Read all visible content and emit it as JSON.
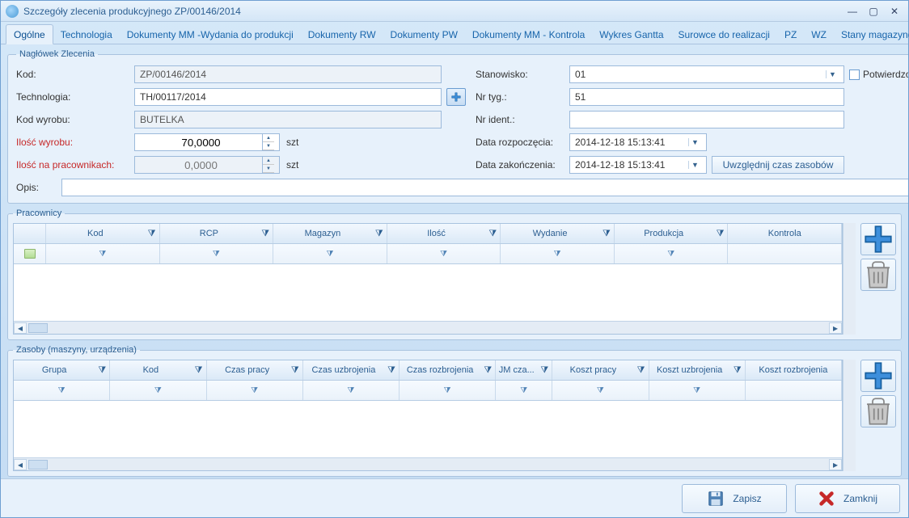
{
  "window": {
    "title": "Szczegóły zlecenia produkcyjnego ZP/00146/2014"
  },
  "tabs": {
    "items": [
      "Ogólne",
      "Technologia",
      "Dokumenty MM -Wydania do produkcji",
      "Dokumenty RW",
      "Dokumenty PW",
      "Dokumenty MM - Kontrola",
      "Wykres Gantta",
      "Surowce do realizacji",
      "PZ",
      "WZ",
      "Stany magazynowe"
    ],
    "active_index": 0
  },
  "header_panel": {
    "legend": "Nagłówek Zlecenia",
    "labels": {
      "kod": "Kod:",
      "technologia": "Technologia:",
      "kodwyrobu": "Kod wyrobu:",
      "iloscwyrobu": "Ilość wyrobu:",
      "iloscprac": "Ilość na pracownikach:",
      "opis": "Opis:",
      "stanowisko": "Stanowisko:",
      "nrtyg": "Nr tyg.:",
      "nrident": "Nr ident.:",
      "datarozp": "Data rozpoczęcia:",
      "datazak": "Data zakończenia:",
      "potwierdzone": "Potwierdzone",
      "uwzglednij": "Uwzględnij czas zasobów",
      "szt": "szt"
    },
    "values": {
      "kod": "ZP/00146/2014",
      "technologia": "TH/00117/2014",
      "kodwyrobu": "BUTELKA",
      "iloscwyrobu": "70,0000",
      "iloscprac": "0,0000",
      "opis": "",
      "stanowisko": "01",
      "nrtyg": "51",
      "nrident": "",
      "datarozp": "2014-12-18 15:13:41",
      "datazak": "2014-12-18 15:13:41"
    }
  },
  "pracownicy": {
    "legend": "Pracownicy",
    "columns": [
      "",
      "Kod",
      "RCP",
      "Magazyn",
      "Ilość",
      "Wydanie",
      "Produkcja",
      "Kontrola"
    ]
  },
  "zasoby": {
    "legend": "Zasoby (maszyny, urządzenia)",
    "columns": [
      "Grupa",
      "Kod",
      "Czas pracy",
      "Czas uzbrojenia",
      "Czas rozbrojenia",
      "JM cza...",
      "Koszt pracy",
      "Koszt uzbrojenia",
      "Koszt rozbrojenia"
    ]
  },
  "footer": {
    "zapisz": "Zapisz",
    "zamknij": "Zamknij"
  }
}
